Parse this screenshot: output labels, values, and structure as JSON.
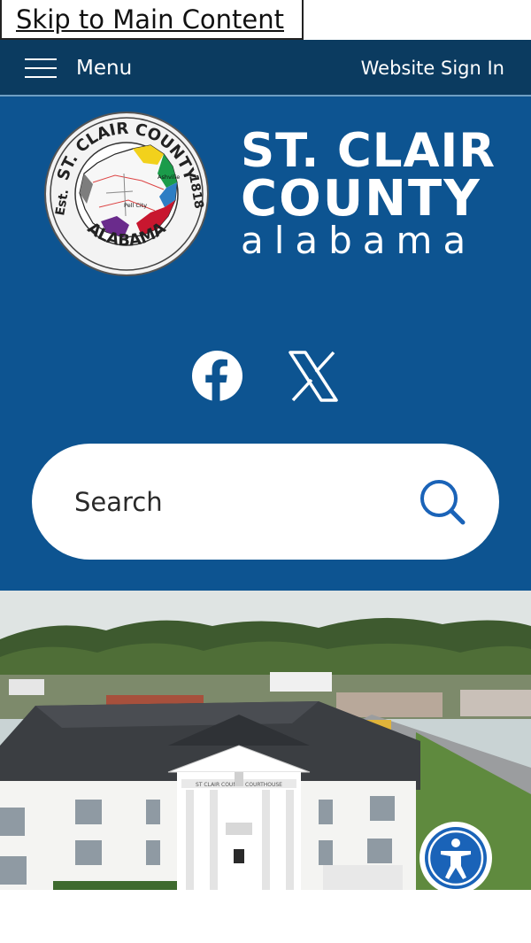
{
  "skip_link": "Skip to Main Content",
  "topnav": {
    "menu_label": "Menu",
    "signin_label": "Website Sign In"
  },
  "seal": {
    "ring_top": "ST. CLAIR COUNTY",
    "ring_bottom": "ALABAMA",
    "left": "Est.",
    "right": "1818",
    "towns": [
      "Ashville",
      "Pell City"
    ]
  },
  "wordmark": {
    "line1": "ST. CLAIR",
    "line2": "COUNTY",
    "line3": "alabama"
  },
  "social": {
    "icons": [
      "facebook-icon",
      "x-icon"
    ]
  },
  "search": {
    "placeholder": "Search"
  },
  "hero": {
    "building_sign": "ST CLAIR COUNTY COURTHOUSE"
  },
  "colors": {
    "nav": "#0b3b60",
    "header": "#0d5491",
    "accent": "#1a63b8"
  }
}
